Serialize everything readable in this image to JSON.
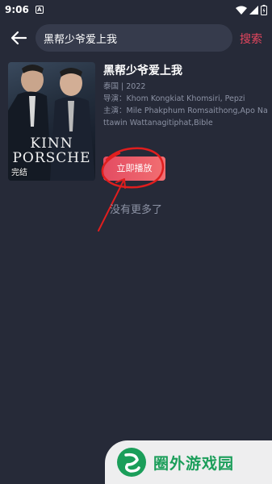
{
  "status_bar": {
    "time": "9:06",
    "notification_letter": "A"
  },
  "search": {
    "query": "黑帮少爷爱上我",
    "button_label": "搜索"
  },
  "result": {
    "title": "黑帮少爷爱上我",
    "meta": "泰国 | 2022",
    "director": "导演：Khom Kongkiat Khomsiri, Pepzi",
    "cast": "主演：Mile Phakphum Romsaithong,Apo Nattawin Wattanagitiphat,Bible",
    "poster_title_line1": "KINN",
    "poster_title_line2": "PORSCHE",
    "poster_badge": "完结",
    "play_label": "立即播放"
  },
  "footer": {
    "no_more": "没有更多了"
  },
  "watermark": {
    "text": "圈外游戏园"
  },
  "colors": {
    "background": "#262a38",
    "accent": "#e4465e",
    "annotation_red": "#e01e1e",
    "watermark_green": "#1b9e5a"
  },
  "icons": [
    "back-arrow-icon",
    "wifi-icon",
    "signal-icon",
    "battery-icon",
    "watermark-logo-icon"
  ]
}
